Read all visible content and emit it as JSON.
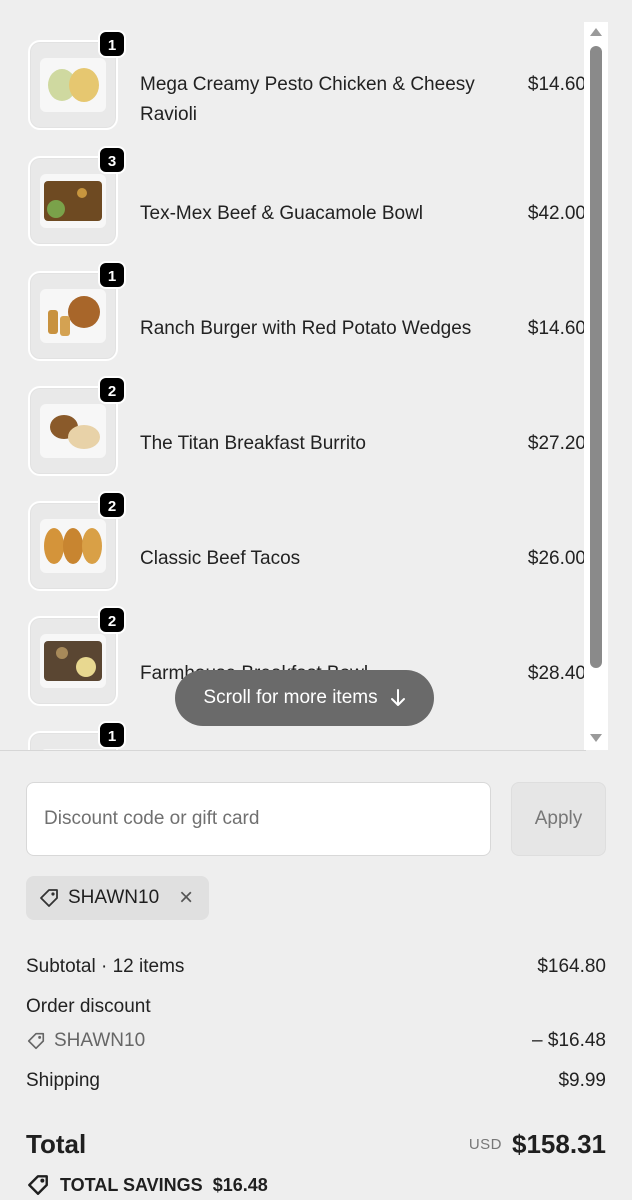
{
  "cart": {
    "items": [
      {
        "name": "Mega Creamy Pesto Chicken & Cheesy Ravioli",
        "price": "$14.60",
        "qty": "1",
        "thumb_icon": "pasta-meal-icon",
        "thumb_color": "#d9c37a"
      },
      {
        "name": "Tex-Mex Beef & Guacamole Bowl",
        "price": "$42.00",
        "qty": "3",
        "thumb_icon": "beef-bowl-meal-icon",
        "thumb_color": "#7a5a2e"
      },
      {
        "name": "Ranch Burger with Red Potato Wedges",
        "price": "$14.60",
        "qty": "1",
        "thumb_icon": "burger-meal-icon",
        "thumb_color": "#b5803f"
      },
      {
        "name": "The Titan Breakfast Burrito",
        "price": "$27.20",
        "qty": "2",
        "thumb_icon": "burrito-meal-icon",
        "thumb_color": "#c49a62"
      },
      {
        "name": "Classic Beef Tacos",
        "price": "$26.00",
        "qty": "2",
        "thumb_icon": "tacos-meal-icon",
        "thumb_color": "#d19a3c"
      },
      {
        "name": "Farmhouse Breakfast Bowl",
        "price": "$28.40",
        "qty": "2",
        "thumb_icon": "breakfast-bowl-meal-icon",
        "thumb_color": "#6b5a3a"
      },
      {
        "name": "",
        "price": "",
        "qty": "1",
        "thumb_icon": "meal-icon",
        "thumb_color": "#d6b27a"
      }
    ],
    "scroll_hint": "Scroll for more items"
  },
  "discount": {
    "placeholder": "Discount code or gift card",
    "apply_label": "Apply",
    "applied_code": "SHAWN10"
  },
  "summary": {
    "subtotal_label": "Subtotal · 12 items",
    "subtotal_value": "$164.80",
    "order_discount_label": "Order discount",
    "discount_code": "SHAWN10",
    "discount_value": "– $16.48",
    "shipping_label": "Shipping",
    "shipping_value": "$9.99",
    "total_label": "Total",
    "currency": "USD",
    "total_value": "$158.31",
    "savings_label": "TOTAL SAVINGS",
    "savings_value": "$16.48"
  },
  "colors": {
    "background": "#eeeeee",
    "badge": "#000000",
    "pill": "#6a6a6a"
  }
}
